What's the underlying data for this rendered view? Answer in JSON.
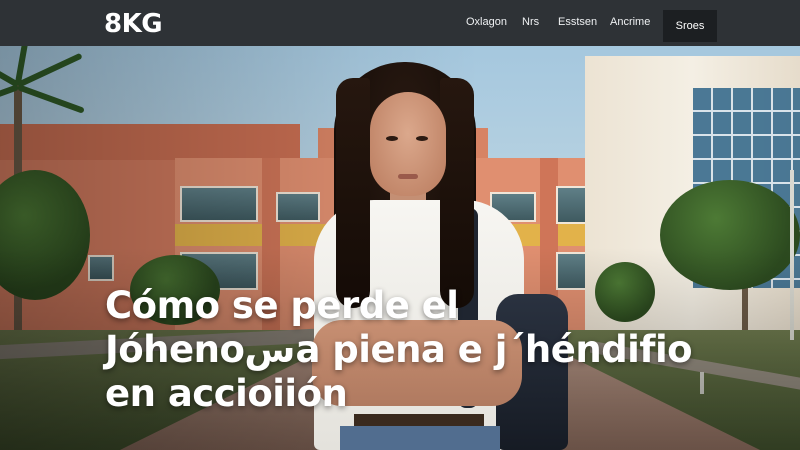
{
  "brand": {
    "logo_text": "8KG"
  },
  "nav": {
    "links": [
      "Oxlagon",
      "Nrs",
      "Esstsen",
      "Ancrime"
    ],
    "cta_label": "Sroes"
  },
  "hero": {
    "headline_lines": [
      "Cómo se perde el",
      "Jóhenoسa piena e j´héndifio",
      "en accioiión"
    ]
  },
  "colors": {
    "navbar_bg": "#2e3236",
    "cta_bg": "#1c1f22",
    "headline_text": "#ffffff"
  }
}
